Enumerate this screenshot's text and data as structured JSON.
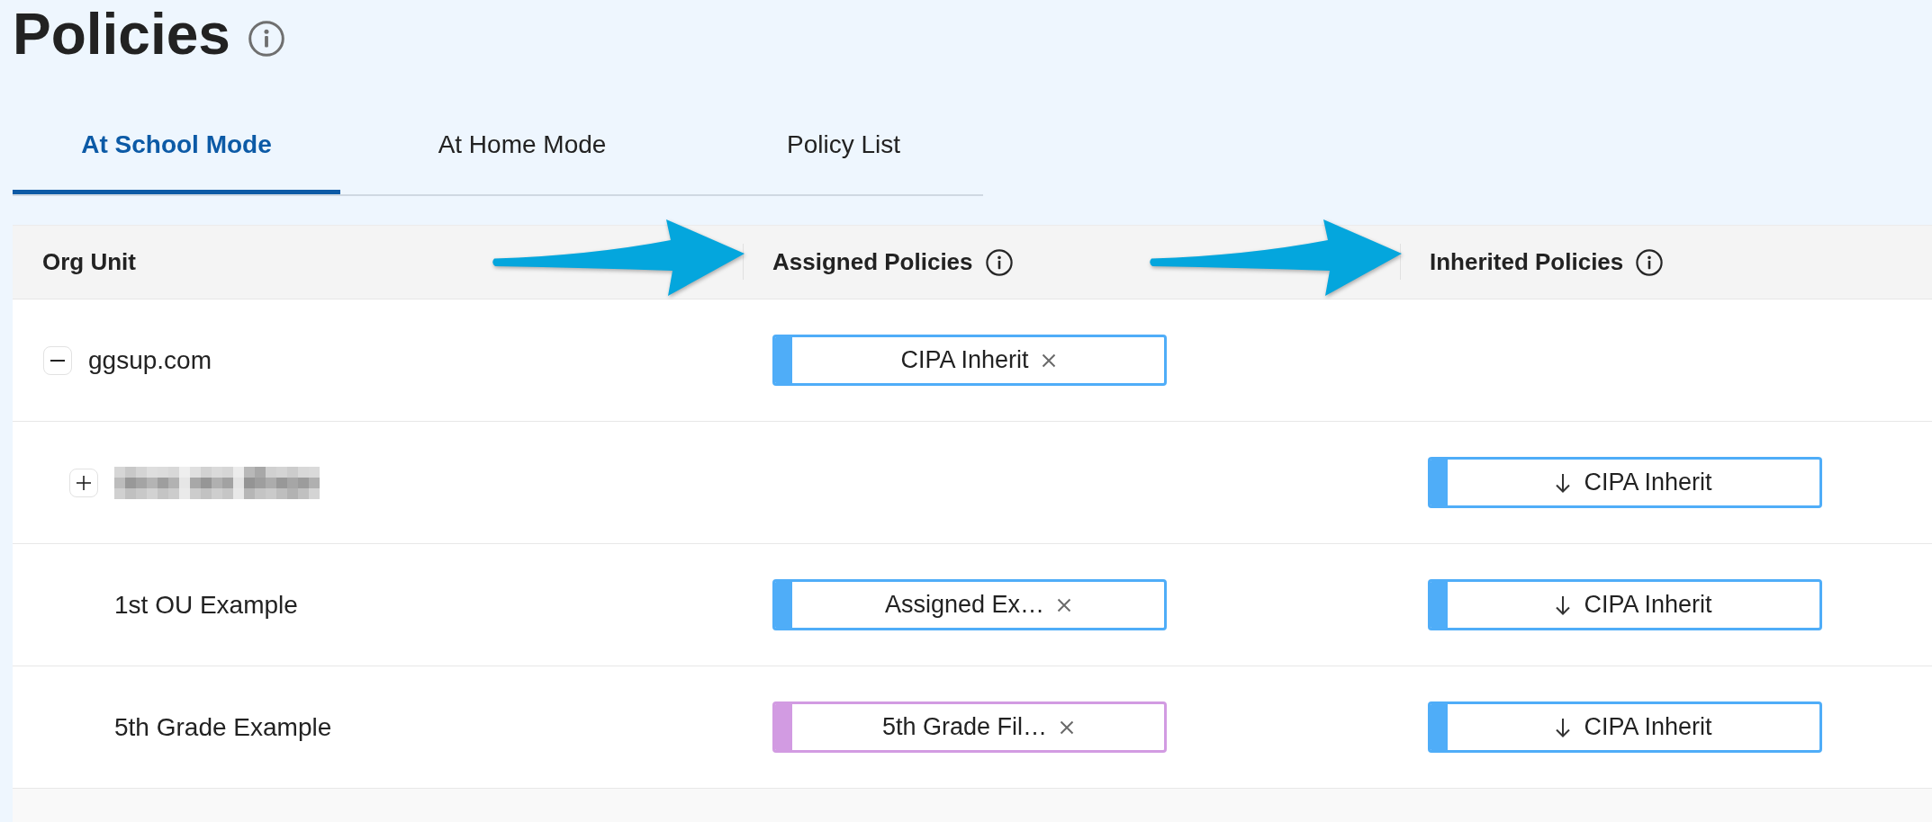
{
  "page": {
    "title": "Policies"
  },
  "tabs": [
    {
      "label": "At School Mode",
      "selected": true
    },
    {
      "label": "At Home Mode",
      "selected": false
    },
    {
      "label": "Policy List",
      "selected": false
    }
  ],
  "table": {
    "columns": [
      {
        "label": "Org Unit",
        "info_icon": false,
        "callout_arrow": false
      },
      {
        "label": "Assigned Policies",
        "info_icon": true,
        "callout_arrow": true
      },
      {
        "label": "Inherited Policies",
        "info_icon": true,
        "callout_arrow": true
      }
    ],
    "rows": [
      {
        "kind": "group",
        "name": "ggsup.com",
        "redacted": false,
        "expanded": true,
        "assigned_policies": [
          {
            "name": "CIPA Inherit",
            "color": "#4fadf8"
          }
        ],
        "children": [
          {
            "kind": "group",
            "redacted": true,
            "expanded": false,
            "inherited_policies": [
              {
                "name": "CIPA Inherit",
                "color": "#4fadf8"
              }
            ]
          },
          {
            "kind": "leaf",
            "name": "1st OU Example",
            "redacted": false,
            "assigned_policies": [
              {
                "name": "Assigned Ex…",
                "color": "#4fadf8"
              }
            ],
            "inherited_policies": [
              {
                "name": "CIPA Inherit",
                "color": "#4fadf8"
              }
            ]
          },
          {
            "kind": "leaf",
            "name": "5th Grade Example",
            "redacted": false,
            "assigned_policies": [
              {
                "name": "5th Grade Fil…",
                "color": "#d29be2"
              }
            ],
            "inherited_policies": [
              {
                "name": "CIPA Inherit",
                "color": "#4fadf8"
              }
            ]
          }
        ]
      }
    ]
  }
}
